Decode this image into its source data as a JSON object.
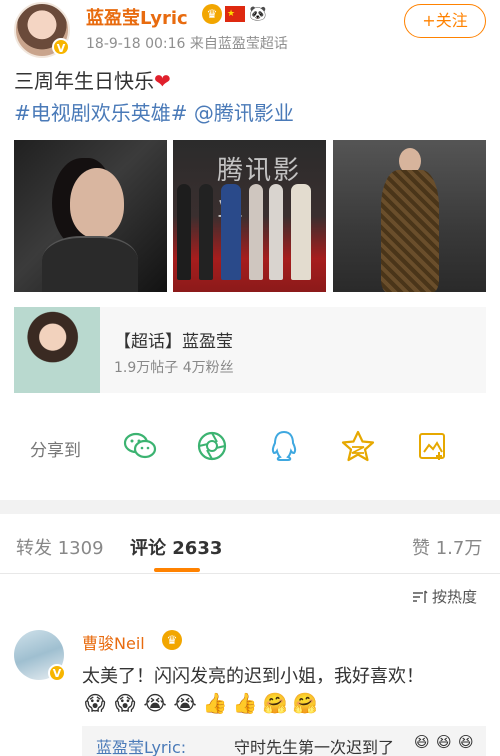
{
  "post": {
    "username": "蓝盈莹Lyric",
    "meta": "18-9-18 00:16  来自蓝盈莹超话",
    "follow_label": "+关注",
    "text": "三周年生日快乐",
    "heart": "❤",
    "tags": "#电视剧欢乐英雄# @腾讯影业",
    "photo2_logo": "腾讯影业"
  },
  "card": {
    "title": "【超话】蓝盈莹",
    "subtitle": "1.9万帖子 4万粉丝"
  },
  "share": {
    "label": "分享到",
    "icons": [
      "wechat-icon",
      "moments-icon",
      "qq-icon",
      "qzone-icon",
      "save-image-icon"
    ]
  },
  "tabs": {
    "repost": "转发 1309",
    "comments": "评论 2633",
    "likes": "赞 1.7万"
  },
  "sort_label": "按热度",
  "comment": {
    "username": "曹骏Neil",
    "text": "太美了！闪闪发亮的迟到小姐，我好喜欢！",
    "emojis": [
      "😱",
      "😱",
      "😭",
      "😭",
      "👍",
      "👍",
      "🤗",
      "🤗"
    ]
  },
  "reply": {
    "username": "蓝盈莹Lyric:",
    "text": "守时先生第一次迟到了",
    "emojis": [
      "😆",
      "😆",
      "😆"
    ]
  },
  "colors": {
    "accent": "#ff8200",
    "username": "#e86b0f",
    "link": "#4a7ab8"
  }
}
